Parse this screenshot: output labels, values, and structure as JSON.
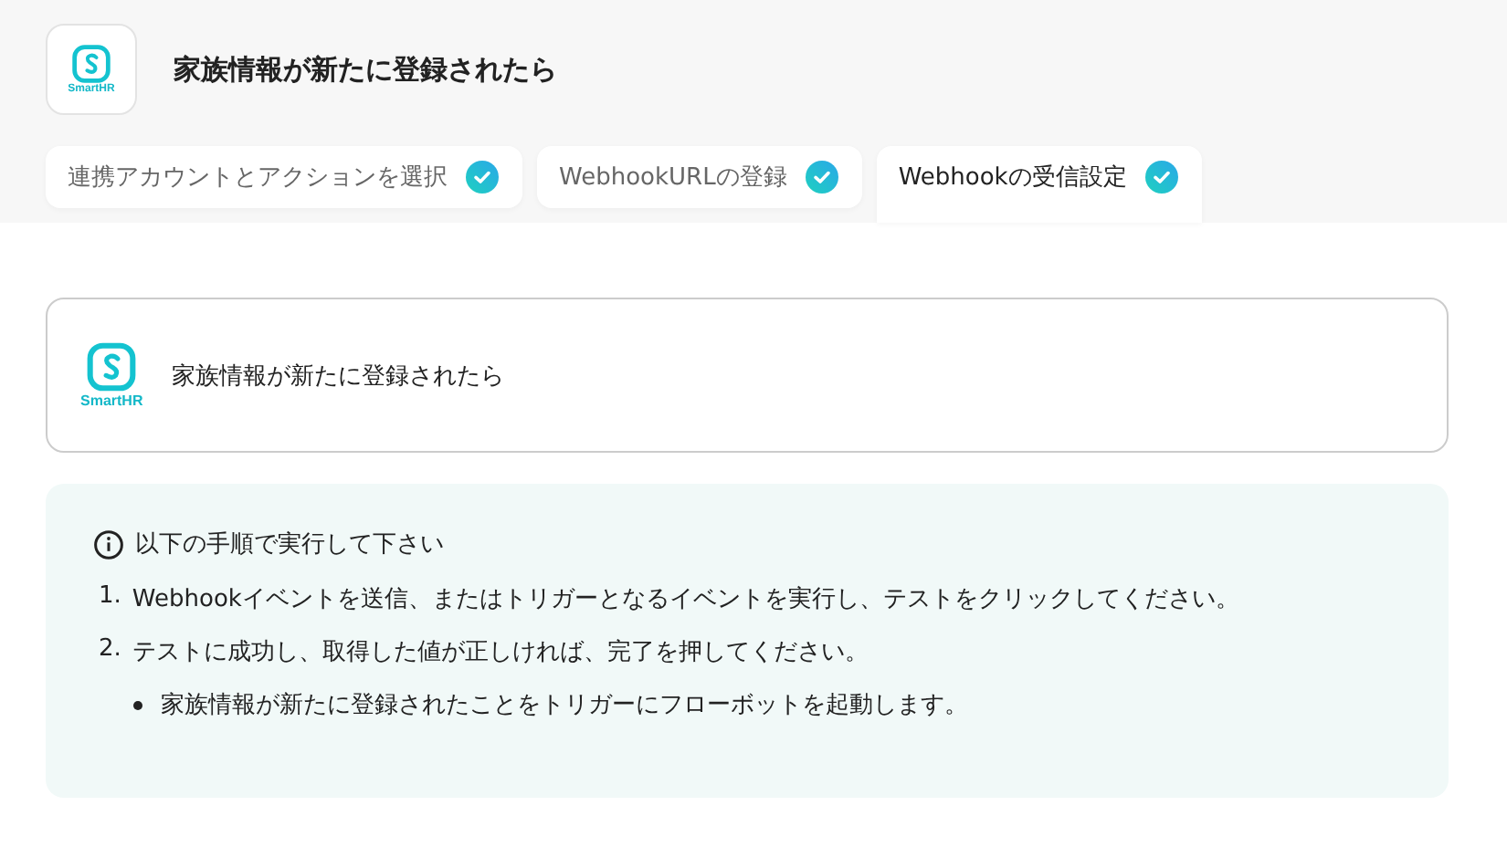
{
  "header": {
    "logo_text": "SmartHR",
    "title": "家族情報が新たに登録されたら"
  },
  "tabs": [
    {
      "label": "連携アカウントとアクションを選択",
      "selected": false,
      "done": true
    },
    {
      "label": "WebhookURLの登録",
      "selected": false,
      "done": true
    },
    {
      "label": "Webhookの受信設定",
      "selected": true,
      "done": true
    }
  ],
  "trigger_card": {
    "logo_text": "SmartHR",
    "title": "家族情報が新たに登録されたら"
  },
  "instructions": {
    "heading": "以下の手順で実行して下さい",
    "steps": [
      {
        "number": "1.",
        "text": "Webhookイベントを送信、またはトリガーとなるイベントを実行し、テストをクリックしてください。"
      },
      {
        "number": "2.",
        "text": "テストに成功し、取得した値が正しければ、完了を押してください。"
      }
    ],
    "bullets": [
      "家族情報が新たに登録されたことをトリガーにフローボットを起動します。"
    ]
  }
}
